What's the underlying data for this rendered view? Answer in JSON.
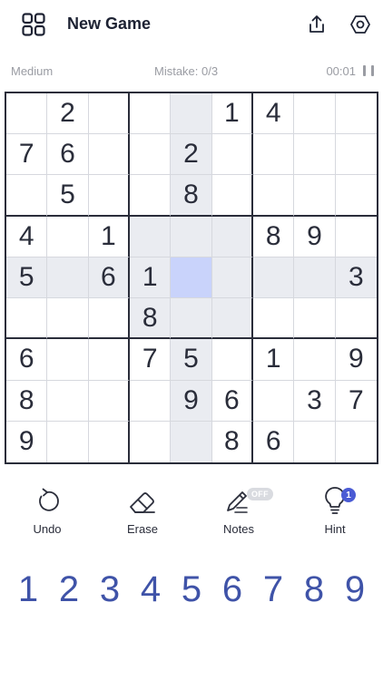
{
  "header": {
    "title": "New Game",
    "menu_icon": "grid-icon",
    "share_icon": "share-icon",
    "settings_icon": "gear-icon"
  },
  "status": {
    "difficulty": "Medium",
    "mistakes": "Mistake: 0/3",
    "timer": "00:01",
    "pause_icon": "pause-icon"
  },
  "board": {
    "rows": [
      [
        "",
        "2",
        "",
        "",
        "",
        "1",
        "4",
        "",
        ""
      ],
      [
        "7",
        "6",
        "",
        "",
        "2",
        "",
        "",
        "",
        ""
      ],
      [
        "",
        "5",
        "",
        "",
        "8",
        "",
        "",
        "",
        ""
      ],
      [
        "4",
        "",
        "1",
        "",
        "",
        "",
        "8",
        "9",
        ""
      ],
      [
        "5",
        "",
        "6",
        "1",
        "",
        "",
        "",
        "",
        "3"
      ],
      [
        "",
        "",
        "",
        "8",
        "",
        "",
        "",
        "",
        ""
      ],
      [
        "6",
        "",
        "",
        "7",
        "5",
        "",
        "1",
        "",
        "9"
      ],
      [
        "8",
        "",
        "",
        "",
        "9",
        "6",
        "",
        "3",
        "7"
      ],
      [
        "9",
        "",
        "",
        "",
        "",
        "8",
        "6",
        "",
        ""
      ]
    ],
    "selected_row": 4,
    "selected_col": 4,
    "highlight_color": "#eaecf1",
    "selected_color": "#c9d3fb"
  },
  "tools": {
    "undo": "Undo",
    "erase": "Erase",
    "notes": "Notes",
    "notes_state": "OFF",
    "hint": "Hint",
    "hint_count": "1"
  },
  "numpad": [
    "1",
    "2",
    "3",
    "4",
    "5",
    "6",
    "7",
    "8",
    "9"
  ],
  "colors": {
    "accent": "#4a5bd4",
    "number_pad": "#3f53a8",
    "grid_line": "#2a2d3a"
  }
}
